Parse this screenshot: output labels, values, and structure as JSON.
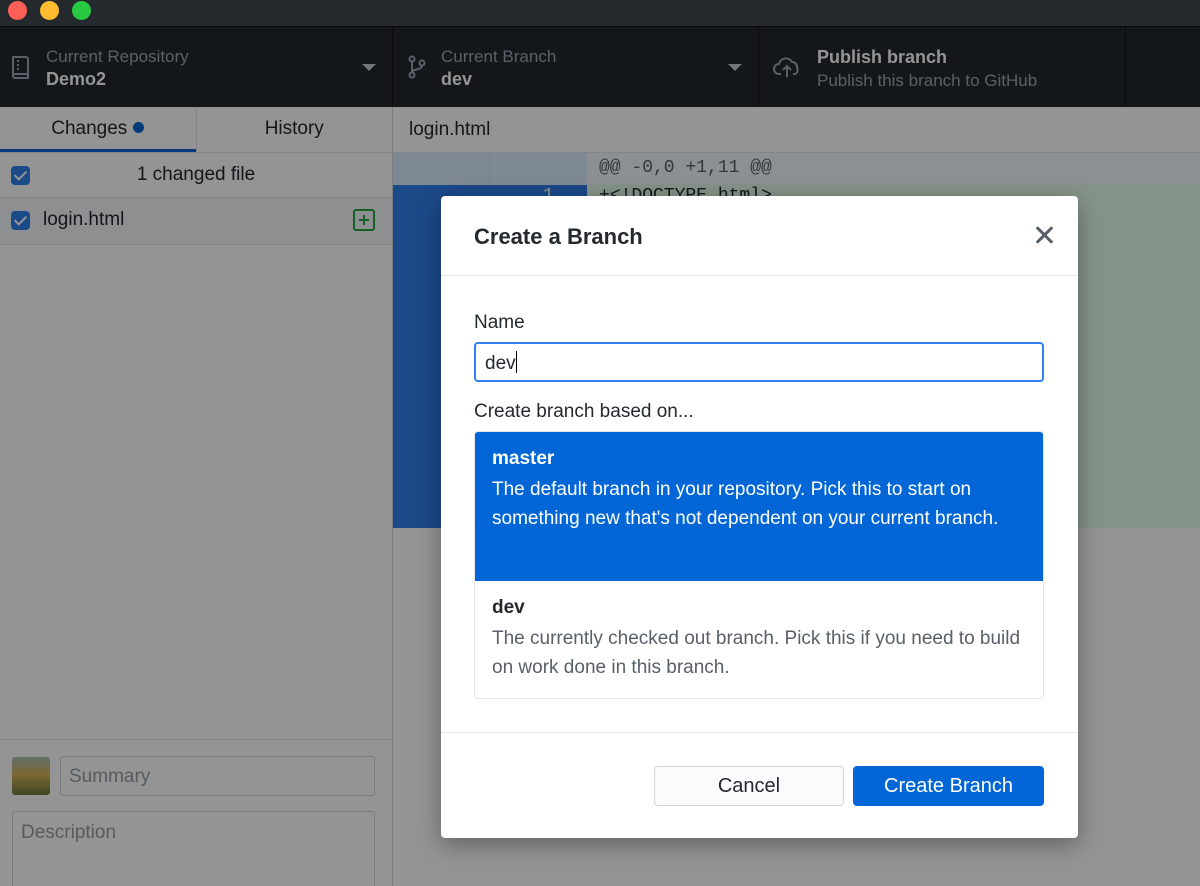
{
  "toolbar": {
    "repo_caption": "Current Repository",
    "repo_value": "Demo2",
    "branch_caption": "Current Branch",
    "branch_value": "dev",
    "publish_title": "Publish branch",
    "publish_sub": "Publish this branch to GitHub"
  },
  "sidebar": {
    "tabs": [
      {
        "label": "Changes",
        "active": true
      },
      {
        "label": "History",
        "active": false
      }
    ],
    "changed_header": "1 changed file",
    "files": [
      {
        "name": "login.html",
        "status": "added"
      }
    ],
    "summary_placeholder": "Summary",
    "description_placeholder": "Description"
  },
  "diff": {
    "path": "login.html",
    "hunk_header": "@@ -0,0 +1,11 @@",
    "first_line_no": "1",
    "first_line": "+<!DOCTYPE html>"
  },
  "dialog": {
    "title": "Create a Branch",
    "name_label": "Name",
    "name_value": "dev",
    "based_on_label": "Create branch based on...",
    "options": [
      {
        "name": "master",
        "description": "The default branch in your repository. Pick this to start on something new that's not dependent on your current branch.",
        "selected": true
      },
      {
        "name": "dev",
        "description": "The currently checked out branch. Pick this if you need to build on work done in this branch.",
        "selected": false
      }
    ],
    "cancel_label": "Cancel",
    "create_label": "Create Branch"
  },
  "colors": {
    "accent": "#0366d6",
    "toolbar_bg": "#24292e",
    "added_status": "#28a745"
  },
  "icons": [
    "repo-icon",
    "branch-icon",
    "cloud-upload-icon",
    "close-icon",
    "file-added-icon"
  ]
}
